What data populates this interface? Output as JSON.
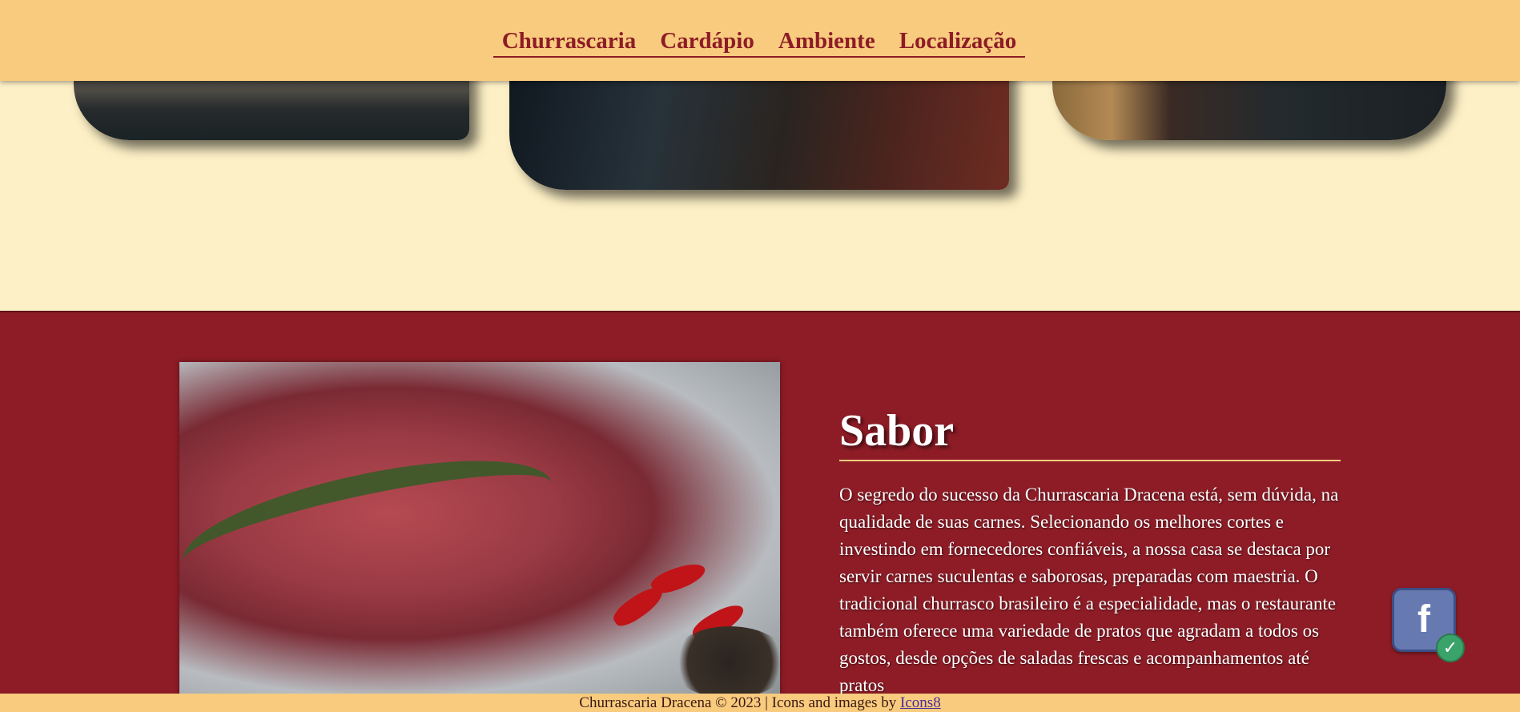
{
  "nav": {
    "items": [
      {
        "label": "Churrascaria"
      },
      {
        "label": "Cardápio"
      },
      {
        "label": "Ambiente"
      },
      {
        "label": "Localização"
      }
    ]
  },
  "gallery": {
    "images": [
      "buffet-photo-left",
      "buffet-photo-center",
      "buffet-photo-right"
    ]
  },
  "section": {
    "title": "Sabor",
    "text": "O segredo do sucesso da Churrascaria Dracena está, sem dúvida, na qualidade de suas carnes. Selecionando os melhores cortes e investindo em fornecedores confiáveis, a nossa casa se destaca por servir carnes suculentas e saborosas, preparadas com maestria. O tradicional churrasco brasileiro é a especialidade, mas o restaurante também oferece uma variedade de pratos que agradam a todos os gostos, desde opções de saladas frescas e acompanhamentos até pratos",
    "image": "raw-steak-rosemary-peppers-photo"
  },
  "social": {
    "icon": "facebook-icon",
    "glyph": "f",
    "badge_icon": "check-icon",
    "badge_glyph": "✓"
  },
  "footer": {
    "text": "Churrascaria Dracena © 2023 | Icons and images by ",
    "link": "Icons8"
  },
  "colors": {
    "header_bg": "#f8cb7e",
    "page_bg": "#fdf0c6",
    "section_bg": "#8d1c26",
    "nav_text": "#8d1c26"
  }
}
